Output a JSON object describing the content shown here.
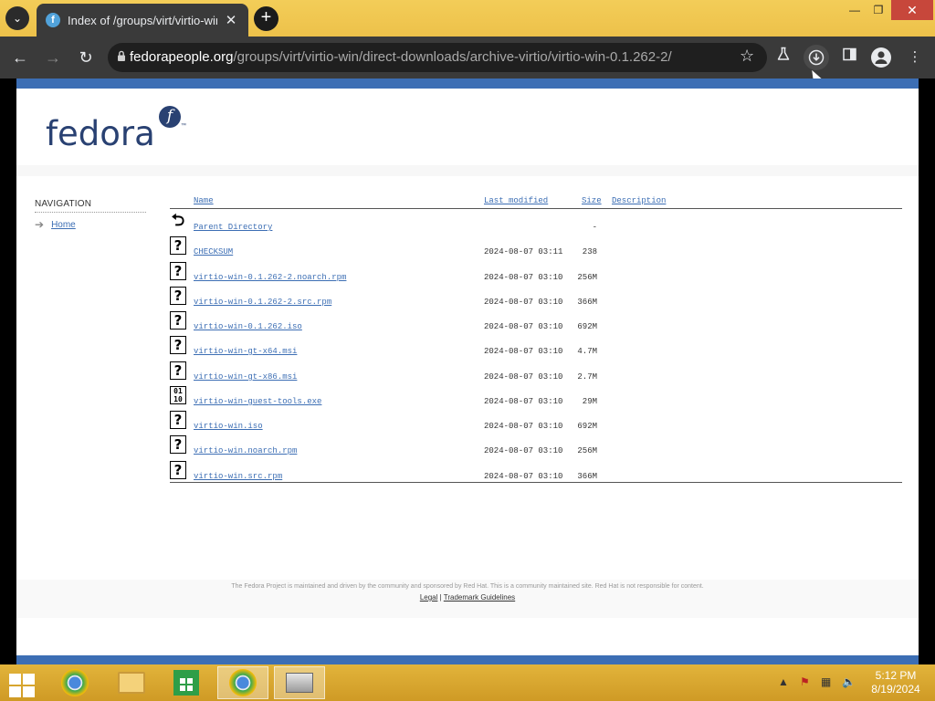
{
  "browser": {
    "tab_title": "Index of /groups/virt/virtio-win",
    "tab_close": "✕",
    "new_tab": "+",
    "url_host": "fedorapeople.org",
    "url_path": "/groups/virt/virtio-win/direct-downloads/archive-virtio/virtio-win-0.1.262-2/",
    "window_controls": {
      "minimize": "—",
      "maximize": "❐",
      "close": "✕"
    }
  },
  "header": {
    "logo_text": "fedora",
    "logo_badge": "f",
    "logo_tm": "™"
  },
  "navigation": {
    "heading": "NAVIGATION",
    "home_label": "Home"
  },
  "listing": {
    "columns": {
      "name": "Name",
      "last_modified": "Last modified",
      "size": "Size",
      "description": "Description"
    },
    "rows": [
      {
        "name": "Parent Directory",
        "date": "",
        "size": "-",
        "icon": "back-icon"
      },
      {
        "name": "CHECKSUM",
        "date": "2024-08-07 03:11",
        "size": "238",
        "icon": "unknown-file-icon"
      },
      {
        "name": "virtio-win-0.1.262-2.noarch.rpm",
        "date": "2024-08-07 03:10",
        "size": "256M",
        "icon": "unknown-file-icon"
      },
      {
        "name": "virtio-win-0.1.262-2.src.rpm",
        "date": "2024-08-07 03:10",
        "size": "366M",
        "icon": "unknown-file-icon"
      },
      {
        "name": "virtio-win-0.1.262.iso",
        "date": "2024-08-07 03:10",
        "size": "692M",
        "icon": "unknown-file-icon"
      },
      {
        "name": "virtio-win-gt-x64.msi",
        "date": "2024-08-07 03:10",
        "size": "4.7M",
        "icon": "unknown-file-icon"
      },
      {
        "name": "virtio-win-gt-x86.msi",
        "date": "2024-08-07 03:10",
        "size": "2.7M",
        "icon": "unknown-file-icon"
      },
      {
        "name": "virtio-win-guest-tools.exe",
        "date": "2024-08-07 03:10",
        "size": "29M",
        "icon": "binary-file-icon"
      },
      {
        "name": "virtio-win.iso",
        "date": "2024-08-07 03:10",
        "size": "692M",
        "icon": "unknown-file-icon"
      },
      {
        "name": "virtio-win.noarch.rpm",
        "date": "2024-08-07 03:10",
        "size": "256M",
        "icon": "unknown-file-icon"
      },
      {
        "name": "virtio-win.src.rpm",
        "date": "2024-08-07 03:10",
        "size": "366M",
        "icon": "unknown-file-icon"
      }
    ]
  },
  "footer": {
    "text": "The Fedora Project is maintained and driven by the community and sponsored by Red Hat. This is a community maintained site. Red Hat is not responsible for content.",
    "legal": "Legal",
    "separator": "|",
    "trademark": "Trademark Guidelines"
  },
  "taskbar": {
    "time": "5:12 PM",
    "date": "8/19/2024"
  }
}
